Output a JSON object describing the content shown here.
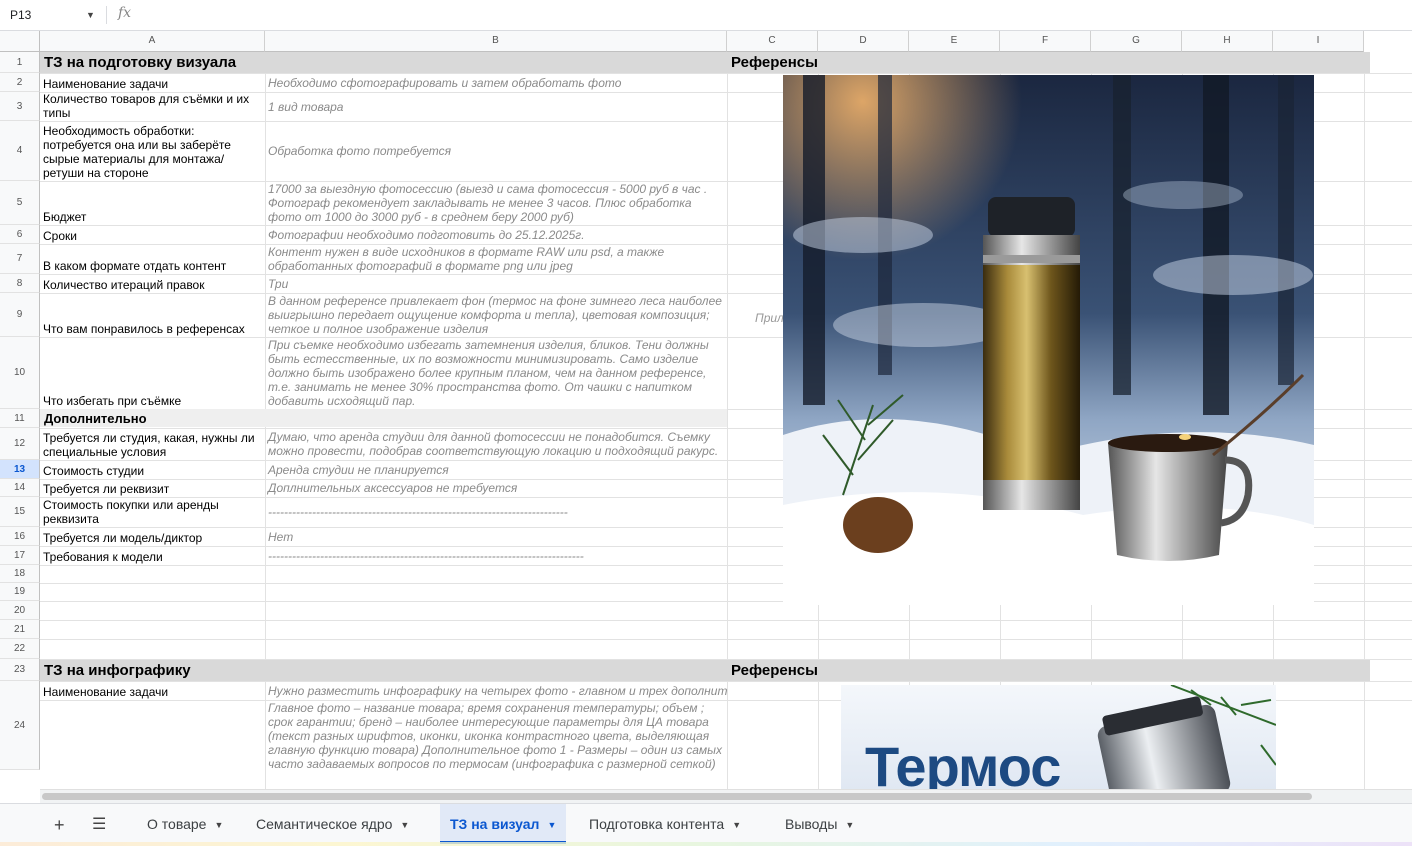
{
  "formula_bar": {
    "name_box": "P13",
    "fx": "fx"
  },
  "columns": [
    "A",
    "B",
    "C",
    "D",
    "E",
    "F",
    "G",
    "H",
    "I"
  ],
  "rows": [
    "1",
    "2",
    "3",
    "4",
    "5",
    "6",
    "7",
    "8",
    "9",
    "10",
    "11",
    "12",
    "13",
    "14",
    "15",
    "16",
    "17",
    "18",
    "19",
    "20",
    "21",
    "22",
    "23",
    "24"
  ],
  "selected_row": "13",
  "section1": {
    "title": "ТЗ на подготовку визуала",
    "ref_title": "Референсы",
    "items": [
      {
        "label": "Наименование задачи",
        "value": "Необходимо сфотографировать и затем обработать фото"
      },
      {
        "label": "Количество товаров для съёмки и их типы",
        "value": "1 вид товара"
      },
      {
        "label": "Необходимость обработки: потребуется она или вы заберёте сырые материалы для монтажа/ретуши на стороне",
        "value": "Обработка фото потребуется"
      },
      {
        "label": "Бюджет",
        "value": "17000 за выездную фотосессию (выезд и сама фотосессия - 5000 руб в час . Фотограф рекомендует закладывать не менее 3 часов. Плюс обработка фото от 1000 до 3000 руб - в среднем беру 2000 руб)"
      },
      {
        "label": "Сроки",
        "value": "Фотографии необходимо подготовить до 25.12.2025г."
      },
      {
        "label": "В каком формате отдать контент",
        "value": "Контент нужен в виде исходников в формате RAW или psd, а также обработанных фотографий  в формате png или jpeg"
      },
      {
        "label": "Количество итераций правок",
        "value": "Три"
      },
      {
        "label": "Что вам понравилось в референсах",
        "value": "В данном референсе привлекает фон (термос на фоне зимнего леса наиболее выигрышно передает ощущение комфорта и тепла), цветовая композиция; четкое и полное изображение изделия"
      },
      {
        "label": "Что избегать при съёмке",
        "value": "При съемке необходимо избегать затемнения изделия, бликов. Тени должны быть естесственные, их по возможности минимизировать. Само изделие должно быть изображено более крупным планом, чем на данном референсе, т.е. занимать не менее 30% пространства фото. От чашки с напитком добавить исходящий пар."
      }
    ],
    "sub_title": "Дополнительно",
    "extra": [
      {
        "label": "Требуется ли студия, какая, нужны ли специальные условия",
        "value": "Думаю, что аренда студии для данной фотосессии не понадобится. Съемку можно провести, подобрав соответствующую локацию и  подходящий ракурс."
      },
      {
        "label": "Стоимость студии",
        "value": "Аренда студии не планируется"
      },
      {
        "label": "Требуется ли реквизит",
        "value": "Доплнительных аксессуаров не требуется"
      },
      {
        "label": "Стоимость покупки или аренды реквизита",
        "value": "---------------------------------------------------------------------------"
      },
      {
        "label": "Требуется ли модель/диктор",
        "value": "Нет"
      },
      {
        "label": "Требования к модели",
        "value": "-------------------------------------------------------------------------------"
      }
    ],
    "pril": "Прил"
  },
  "section2": {
    "title": "ТЗ на инфографику",
    "ref_title": "Референсы",
    "label": "Наименование задачи",
    "value_line1": "Нужно разместить инфографику на четырех фото - главном и трех дополнит",
    "value_rest": "Главное фото – название товара; время сохранения температуры; объем ; срок гарантии; бренд – наиболее интересующие параметры для ЦА товара (текст разных шрифтов, иконки, иконка контрастного цвета, выделяющая главную функцию товара) Дополнительное фото 1 - Размеры – один из самых часто задаваемых вопросов по термосам  (инфографика с размерной сеткой)",
    "ref_image_text": "Термос"
  },
  "tabs": [
    {
      "label": "О товаре",
      "active": false
    },
    {
      "label": "Семантическое ядро",
      "active": false
    },
    {
      "label": "ТЗ на визуал",
      "active": true
    },
    {
      "label": "Подготовка контента",
      "active": false
    },
    {
      "label": "Выводы",
      "active": false
    }
  ],
  "icons": {
    "add_sheet": "plus-icon",
    "all_sheets": "list-icon"
  }
}
